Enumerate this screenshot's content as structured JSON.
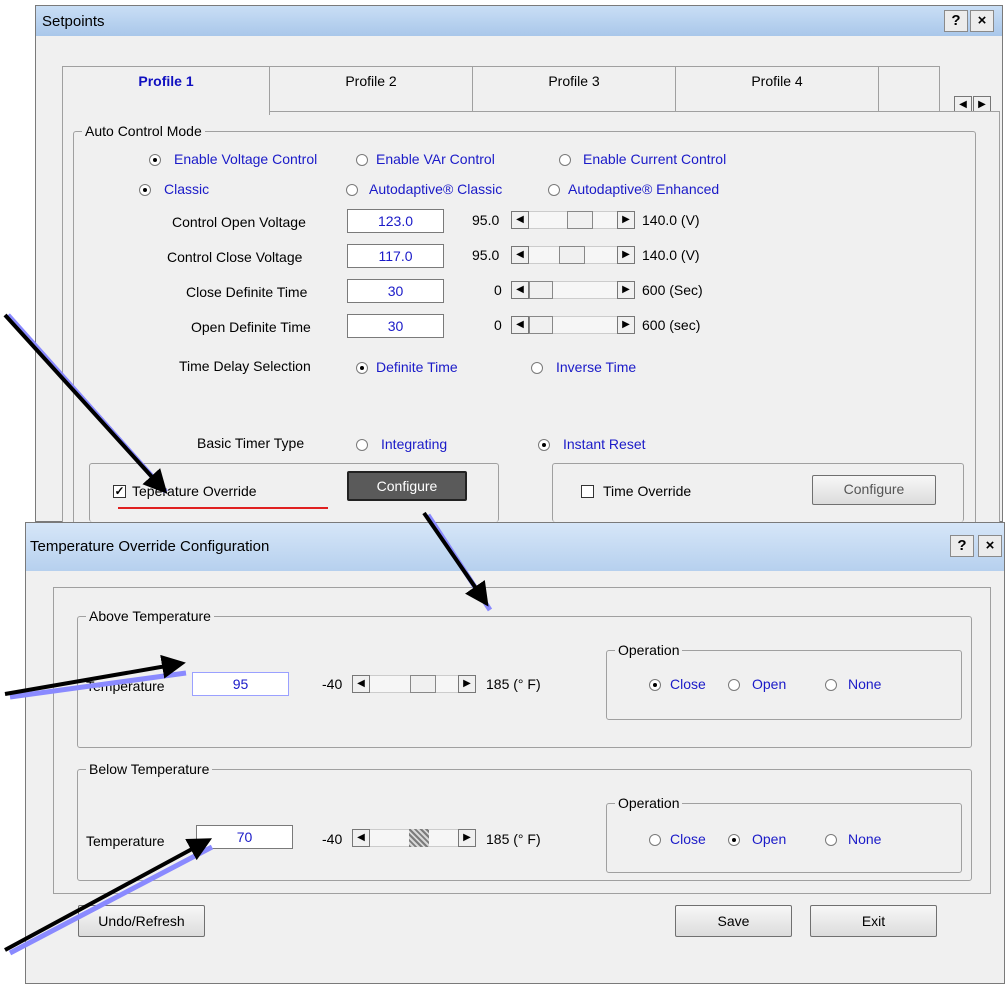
{
  "setpoints": {
    "title": "Setpoints",
    "help": "?",
    "close": "×",
    "tabs": [
      "Profile 1",
      "Profile 2",
      "Profile 3",
      "Profile 4"
    ],
    "auto_mode_label": "Auto Control Mode",
    "control_options": [
      "Enable Voltage Control",
      "Enable VAr Control",
      "Enable Current Control"
    ],
    "algorithm_options": [
      "Classic",
      "Autodaptive® Classic",
      "Autodaptive® Enhanced"
    ],
    "rows": [
      {
        "label": "Control Open Voltage",
        "value": "123.0",
        "min": "95.0",
        "max": "140.0 (V)"
      },
      {
        "label": "Control Close Voltage",
        "value": "117.0",
        "min": "95.0",
        "max": "140.0 (V)"
      },
      {
        "label": "Close Definite Time",
        "value": "30",
        "min": "0",
        "max": "600 (Sec)"
      },
      {
        "label": "Open Definite Time",
        "value": "30",
        "min": "0",
        "max": "600 (sec)"
      }
    ],
    "time_delay_label": "Time Delay Selection",
    "time_delay_options": [
      "Definite Time",
      "Inverse Time"
    ],
    "timer_type_label": "Basic Timer Type",
    "timer_type_options": [
      "Integrating",
      "Instant Reset"
    ],
    "temperature_override_label": "Temperature Override",
    "temperature_override_visible": "Te",
    "temperature_override_rest": "perature Override",
    "configure_label": "Configure",
    "time_override_label": "Time Override",
    "configure2_label": "Configure"
  },
  "temp_dialog": {
    "title": "Temperature Override Configuration",
    "help": "?",
    "close": "×",
    "above_label": "Above Temperature",
    "below_label": "Below Temperature",
    "temperature_label": "Temperature",
    "above_value": "95",
    "below_value": "70",
    "range_min": "-40",
    "range_max": "185 (° F)",
    "operation_label": "Operation",
    "operation_options": [
      "Close",
      "Open",
      "None"
    ],
    "undo_label": "Undo/Refresh",
    "save_label": "Save",
    "exit_label": "Exit"
  }
}
